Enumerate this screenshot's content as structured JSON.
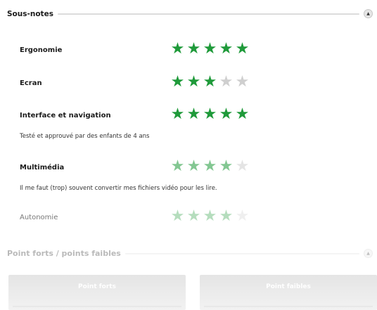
{
  "section1": {
    "title": "Sous-notes",
    "toggle_icon": "collapse-arrow-up"
  },
  "ratings": [
    {
      "label": "Ergonomie",
      "stars": 5,
      "max": 5,
      "desc": ""
    },
    {
      "label": "Ecran",
      "stars": 3,
      "max": 5,
      "desc": ""
    },
    {
      "label": "Interface et navigation",
      "stars": 5,
      "max": 5,
      "desc": "Testé et approuvé par des enfants de 4 ans"
    },
    {
      "label": "Multimédia",
      "stars": 4,
      "max": 5,
      "desc": "Il me faut (trop) souvent convertir mes fichiers vidéo pour les lire."
    },
    {
      "label": "Autonomie",
      "stars": 4,
      "max": 5,
      "desc": ""
    }
  ],
  "section2": {
    "title": "Point forts / points faibles"
  },
  "panels": {
    "left_title": "Point forts",
    "right_title": "Point faibles"
  },
  "colors": {
    "star_on": "#1f9a3a",
    "star_off": "#cfcfcf"
  }
}
